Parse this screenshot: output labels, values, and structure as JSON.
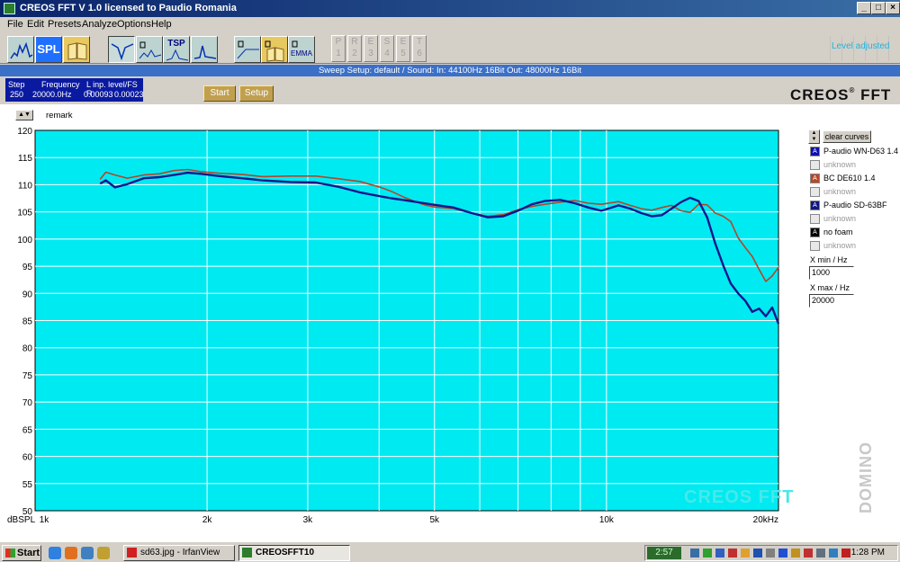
{
  "window": {
    "title": "CREOS FFT V 1.0   licensed to Paudio Romania"
  },
  "menu": [
    "File",
    "Edit",
    "Presets",
    "Analyze",
    "Options",
    "Help"
  ],
  "toolbar": {
    "spl_label": "SPL",
    "tsp_label": "TSP",
    "emma_label": "EMMA",
    "presets": [
      {
        "top": "P",
        "num": "1"
      },
      {
        "top": "R",
        "num": "2"
      },
      {
        "top": "E",
        "num": "3"
      },
      {
        "top": "S",
        "num": "4"
      },
      {
        "top": "E",
        "num": "5"
      },
      {
        "top": "T",
        "num": "6"
      }
    ],
    "level_indicator": "Level adjusted"
  },
  "sweep_status": "Sweep   Setup:  default / Sound: In: 44100Hz 16Bit  Out: 48000Hz 16Bit",
  "info": {
    "step_label": "Step",
    "step_value": "250",
    "freq_label": "Frequency",
    "freq_value": "20000.0Hz",
    "level_label": "L  inp. level/FS  R",
    "level_l": "0.00093",
    "level_r": "0.00023"
  },
  "buttons": {
    "start": "Start",
    "setup": "Setup"
  },
  "logo": {
    "text": "CREOS",
    "suffix": "FFT",
    "mark": "®"
  },
  "remark_label": "remark",
  "legend": {
    "clear_label": "clear curves",
    "items": [
      {
        "label": "P-audio WN-D63 1.4",
        "color": "#1010b0",
        "active": true,
        "mark": "A"
      },
      {
        "label": "unknown",
        "color": "#c0c0c0",
        "active": false,
        "mark": ""
      },
      {
        "label": "BC DE610 1.4",
        "color": "#b84828",
        "active": true,
        "mark": "A"
      },
      {
        "label": "unknown",
        "color": "#c0c0c0",
        "active": false,
        "mark": ""
      },
      {
        "label": "P-audio SD-63BF",
        "color": "#101880",
        "active": true,
        "mark": "A"
      },
      {
        "label": "unknown",
        "color": "#c0c0c0",
        "active": false,
        "mark": ""
      },
      {
        "label": "no foam",
        "color": "#000000",
        "active": true,
        "mark": "A"
      },
      {
        "label": "unknown",
        "color": "#c0c0c0",
        "active": false,
        "mark": ""
      }
    ],
    "xmin_label": "X min / Hz",
    "xmin_value": "1000",
    "xmax_label": "X max / Hz",
    "xmax_value": "20000"
  },
  "watermark": "CREOS FFT",
  "domino": "DOMINO",
  "taskbar": {
    "start": "Start",
    "tasks": [
      {
        "label": "sd63.jpg - IrfanView",
        "active": false
      },
      {
        "label": "CREOSFFT10",
        "active": true
      }
    ],
    "timer": "2:57",
    "clock": "1:28 PM"
  },
  "chart_data": {
    "type": "line",
    "xscale": "log",
    "xlim": [
      1000,
      20000
    ],
    "ylim": [
      50,
      120
    ],
    "x_ticks": [
      {
        "value": 1000,
        "label": "1k"
      },
      {
        "value": 2000,
        "label": "2k"
      },
      {
        "value": 3000,
        "label": "3k"
      },
      {
        "value": 5000,
        "label": "5k"
      },
      {
        "value": 10000,
        "label": "10k"
      },
      {
        "value": 20000,
        "label": "20kHz"
      }
    ],
    "y_ticks": [
      120,
      115,
      110,
      105,
      100,
      95,
      90,
      85,
      80,
      75,
      70,
      65,
      60,
      55,
      50
    ],
    "ylabel": "dBSPL",
    "grid": true,
    "series": [
      {
        "name": "BC DE610 1.4",
        "color": "#b0482a",
        "x": [
          1300,
          1330,
          1380,
          1450,
          1550,
          1650,
          1750,
          1850,
          1950,
          2100,
          2300,
          2500,
          2800,
          3100,
          3400,
          3700,
          4000,
          4200,
          4400,
          4600,
          4800,
          5000,
          5400,
          5800,
          6200,
          6600,
          7000,
          7400,
          7800,
          8300,
          8800,
          9300,
          9800,
          10500,
          11000,
          11500,
          12000,
          12500,
          13000,
          13500,
          14000,
          14500,
          15000,
          15500,
          16000,
          16500,
          17000,
          17500,
          18000,
          18500,
          19000,
          19500,
          20000
        ],
        "y": [
          111.0,
          112.3,
          111.8,
          111.2,
          111.8,
          112.0,
          112.6,
          112.8,
          112.4,
          112.1,
          111.9,
          111.5,
          111.6,
          111.6,
          111.1,
          110.6,
          109.6,
          108.8,
          107.8,
          107.0,
          106.3,
          105.9,
          105.6,
          104.8,
          104.2,
          104.5,
          105.4,
          106.0,
          106.4,
          106.8,
          107.1,
          106.6,
          106.4,
          106.9,
          106.2,
          105.6,
          105.3,
          105.8,
          106.2,
          105.2,
          104.9,
          106.4,
          106.3,
          104.8,
          104.2,
          103.2,
          100.2,
          98.4,
          96.8,
          94.4,
          92.2,
          93.2,
          94.8
        ]
      },
      {
        "name": "P-audio SD-63BF",
        "color": "#12168c",
        "x": [
          1300,
          1330,
          1380,
          1450,
          1550,
          1650,
          1750,
          1850,
          1950,
          2100,
          2300,
          2500,
          2800,
          3100,
          3400,
          3700,
          4000,
          4200,
          4400,
          4600,
          4800,
          5000,
          5400,
          5800,
          6200,
          6600,
          7000,
          7400,
          7800,
          8300,
          8800,
          9300,
          9800,
          10500,
          11000,
          11500,
          12000,
          12500,
          13000,
          13500,
          14000,
          14500,
          15000,
          15500,
          16000,
          16500,
          17000,
          17500,
          18000,
          18500,
          19000,
          19500,
          20000
        ],
        "y": [
          110.2,
          110.8,
          109.5,
          110.1,
          111.2,
          111.4,
          111.8,
          112.2,
          112.0,
          111.6,
          111.2,
          110.8,
          110.5,
          110.4,
          109.6,
          108.6,
          107.9,
          107.5,
          107.2,
          106.9,
          106.6,
          106.3,
          105.8,
          104.8,
          104.0,
          104.2,
          105.2,
          106.4,
          107.0,
          107.2,
          106.6,
          105.8,
          105.2,
          106.2,
          105.6,
          104.8,
          104.2,
          104.4,
          105.6,
          106.8,
          107.6,
          107.0,
          104.0,
          99.2,
          95.2,
          91.8,
          90.0,
          88.6,
          86.6,
          87.2,
          85.8,
          87.4,
          84.4
        ]
      }
    ]
  }
}
